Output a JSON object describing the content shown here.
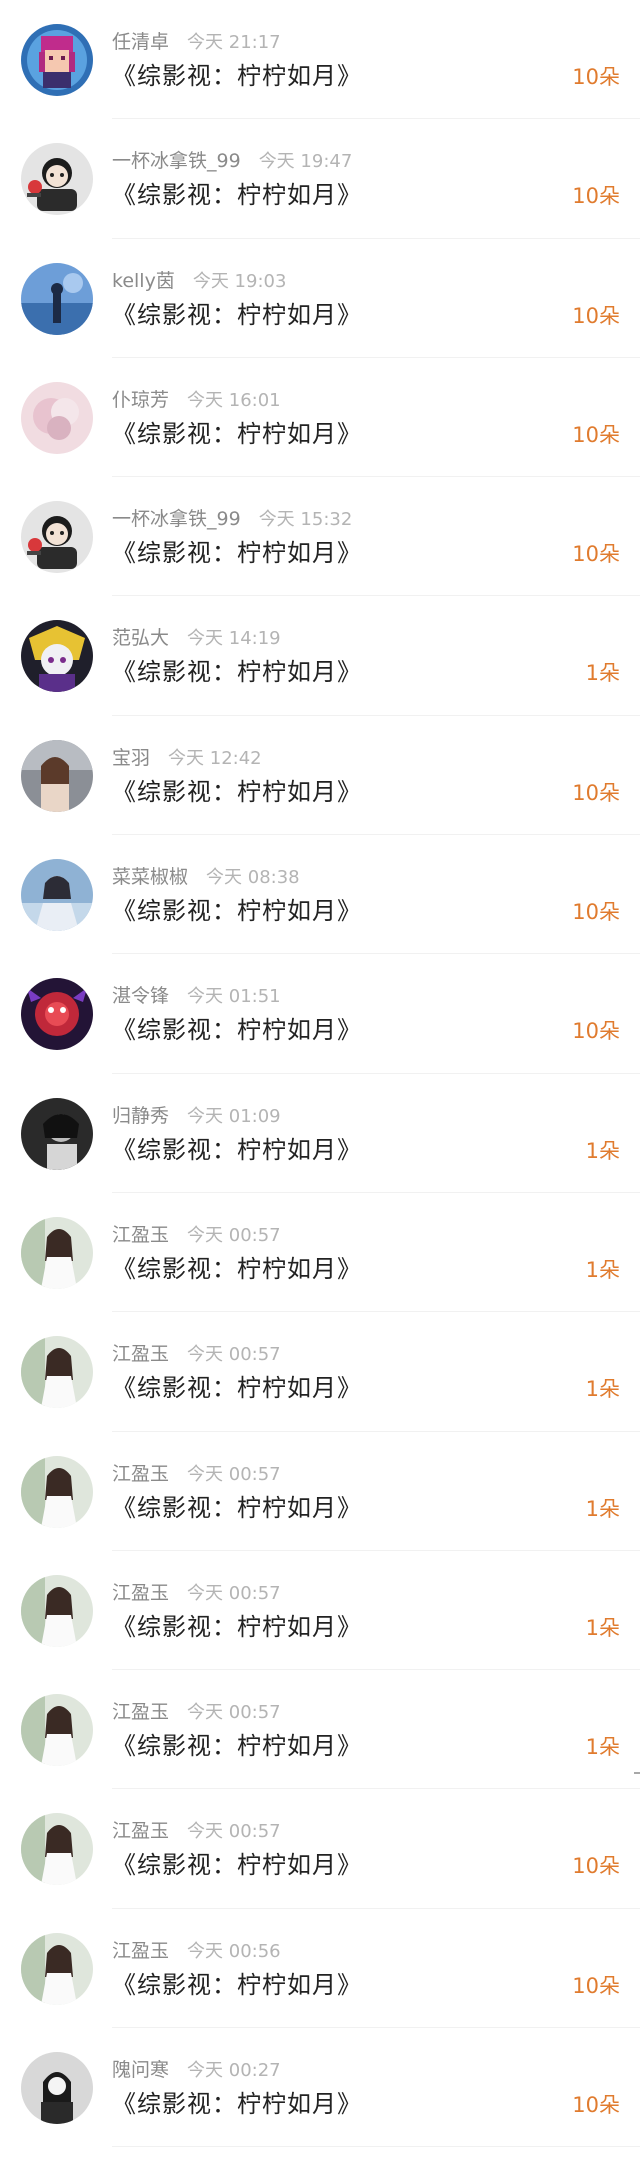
{
  "colors": {
    "name": "#8a8a8a",
    "time": "#b4b4b4",
    "title": "#222222",
    "amount": "#e07b2e",
    "divider": "#f1f1f1"
  },
  "items": [
    {
      "name": "任清卓",
      "time": "今天 21:17",
      "title": "《综影视：柠柠如月》",
      "amount": "10朵",
      "avatar": "pixel-girl-avatar"
    },
    {
      "name": "一杯冰拿铁_99",
      "time": "今天 19:47",
      "title": "《综影视：柠柠如月》",
      "amount": "10朵",
      "avatar": "cartoon-boy-avatar"
    },
    {
      "name": "kelly茵",
      "time": "今天 19:03",
      "title": "《综影视：柠柠如月》",
      "amount": "10朵",
      "avatar": "blue-sky-figure-avatar"
    },
    {
      "name": "仆琼芳",
      "time": "今天 16:01",
      "title": "《综影视：柠柠如月》",
      "amount": "10朵",
      "avatar": "pink-blur-avatar"
    },
    {
      "name": "一杯冰拿铁_99",
      "time": "今天 15:32",
      "title": "《综影视：柠柠如月》",
      "amount": "10朵",
      "avatar": "cartoon-boy-avatar"
    },
    {
      "name": "范弘大",
      "time": "今天 14:19",
      "title": "《综影视：柠柠如月》",
      "amount": "1朵",
      "avatar": "anime-dark-avatar"
    },
    {
      "name": "宝羽",
      "time": "今天 12:42",
      "title": "《综影视：柠柠如月》",
      "amount": "10朵",
      "avatar": "girl-photo-avatar"
    },
    {
      "name": "菜菜椒椒",
      "time": "今天 08:38",
      "title": "《综影视：柠柠如月》",
      "amount": "10朵",
      "avatar": "girl-blue-avatar"
    },
    {
      "name": "湛令锋",
      "time": "今天 01:51",
      "title": "《综影视：柠柠如月》",
      "amount": "10朵",
      "avatar": "red-flower-avatar"
    },
    {
      "name": "归静秀",
      "time": "今天 01:09",
      "title": "《综影视：柠柠如月》",
      "amount": "1朵",
      "avatar": "mono-portrait-avatar"
    },
    {
      "name": "江盈玉",
      "time": "今天 00:57",
      "title": "《综影视：柠柠如月》",
      "amount": "1朵",
      "avatar": "girl-white-dress-avatar"
    },
    {
      "name": "江盈玉",
      "time": "今天 00:57",
      "title": "《综影视：柠柠如月》",
      "amount": "1朵",
      "avatar": "girl-white-dress-avatar"
    },
    {
      "name": "江盈玉",
      "time": "今天 00:57",
      "title": "《综影视：柠柠如月》",
      "amount": "1朵",
      "avatar": "girl-white-dress-avatar"
    },
    {
      "name": "江盈玉",
      "time": "今天 00:57",
      "title": "《综影视：柠柠如月》",
      "amount": "1朵",
      "avatar": "girl-white-dress-avatar"
    },
    {
      "name": "江盈玉",
      "time": "今天 00:57",
      "title": "《综影视：柠柠如月》",
      "amount": "1朵",
      "avatar": "girl-white-dress-avatar"
    },
    {
      "name": "江盈玉",
      "time": "今天 00:57",
      "title": "《综影视：柠柠如月》",
      "amount": "10朵",
      "avatar": "girl-white-dress-avatar"
    },
    {
      "name": "江盈玉",
      "time": "今天 00:56",
      "title": "《综影视：柠柠如月》",
      "amount": "10朵",
      "avatar": "girl-white-dress-avatar"
    },
    {
      "name": "隗问寒",
      "time": "今天 00:27",
      "title": "《综影视：柠柠如月》",
      "amount": "10朵",
      "avatar": "mono-girl-avatar"
    }
  ]
}
